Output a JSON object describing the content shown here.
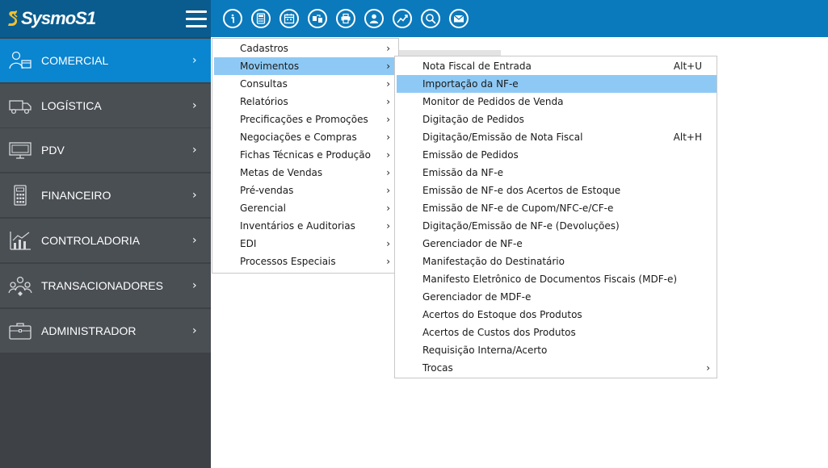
{
  "app": {
    "logo_text": "SysmoS1"
  },
  "toolbar": {
    "buttons": [
      {
        "name": "info-icon"
      },
      {
        "name": "calculator-icon"
      },
      {
        "name": "calendar-icon"
      },
      {
        "name": "transfer-icon"
      },
      {
        "name": "printer-icon"
      },
      {
        "name": "user-icon"
      },
      {
        "name": "chart-icon"
      },
      {
        "name": "search-icon"
      },
      {
        "name": "mail-icon"
      }
    ]
  },
  "sidebar": {
    "items": [
      {
        "label": "COMERCIAL",
        "icon": "people-icon",
        "active": true
      },
      {
        "label": "LOGÍSTICA",
        "icon": "truck-icon"
      },
      {
        "label": "PDV",
        "icon": "monitor-icon"
      },
      {
        "label": "FINANCEIRO",
        "icon": "calculator-icon"
      },
      {
        "label": "CONTROLADORIA",
        "icon": "bar-chart-icon"
      },
      {
        "label": "TRANSACIONADORES",
        "icon": "people-network-icon"
      },
      {
        "label": "ADMINISTRADOR",
        "icon": "briefcase-icon"
      }
    ],
    "chevron": "›"
  },
  "menu_level1": {
    "items": [
      "Cadastros",
      "Movimentos",
      "Consultas",
      "Relatórios",
      "Precificações e Promoções",
      "Negociações e Compras",
      "Fichas Técnicas e Produção",
      "Metas de Vendas",
      "Pré-vendas",
      "Gerencial",
      "Inventários e Auditorias",
      "EDI",
      "Processos Especiais"
    ],
    "highlighted_index": 1,
    "arrow": "›"
  },
  "menu_level2": {
    "items": [
      {
        "label": "Nota Fiscal de Entrada",
        "shortcut": "Alt+U"
      },
      {
        "label": "Importação da NF-e"
      },
      {
        "label": "Monitor de Pedidos de Venda"
      },
      {
        "label": "Digitação de Pedidos"
      },
      {
        "label": "Digitação/Emissão de Nota Fiscal",
        "shortcut": "Alt+H"
      },
      {
        "label": "Emissão de Pedidos"
      },
      {
        "label": "Emissão da NF-e"
      },
      {
        "label": "Emissão de NF-e dos Acertos de Estoque"
      },
      {
        "label": "Emissão de NF-e de Cupom/NFC-e/CF-e"
      },
      {
        "label": "Digitação/Emissão de NF-e (Devoluções)"
      },
      {
        "label": "Gerenciador de NF-e"
      },
      {
        "label": "Manifestação do Destinatário"
      },
      {
        "label": "Manifesto Eletrônico de Documentos Fiscais (MDF-e)"
      },
      {
        "label": "Gerenciador de MDF-e"
      },
      {
        "label": "Acertos do Estoque dos Produtos"
      },
      {
        "label": "Acertos de Custos dos Produtos"
      },
      {
        "label": "Requisição Interna/Acerto"
      },
      {
        "label": "Trocas",
        "submenu": true
      }
    ],
    "highlighted_index": 1,
    "arrow": "›"
  },
  "colors": {
    "topbar": "#0b7abc",
    "logo_area": "#0a5c8f",
    "sidebar_bg": "#3e4246",
    "sidebar_item": "#4a4f54",
    "sidebar_active": "#0a85d0",
    "menu_highlight": "#8ec9f5"
  }
}
